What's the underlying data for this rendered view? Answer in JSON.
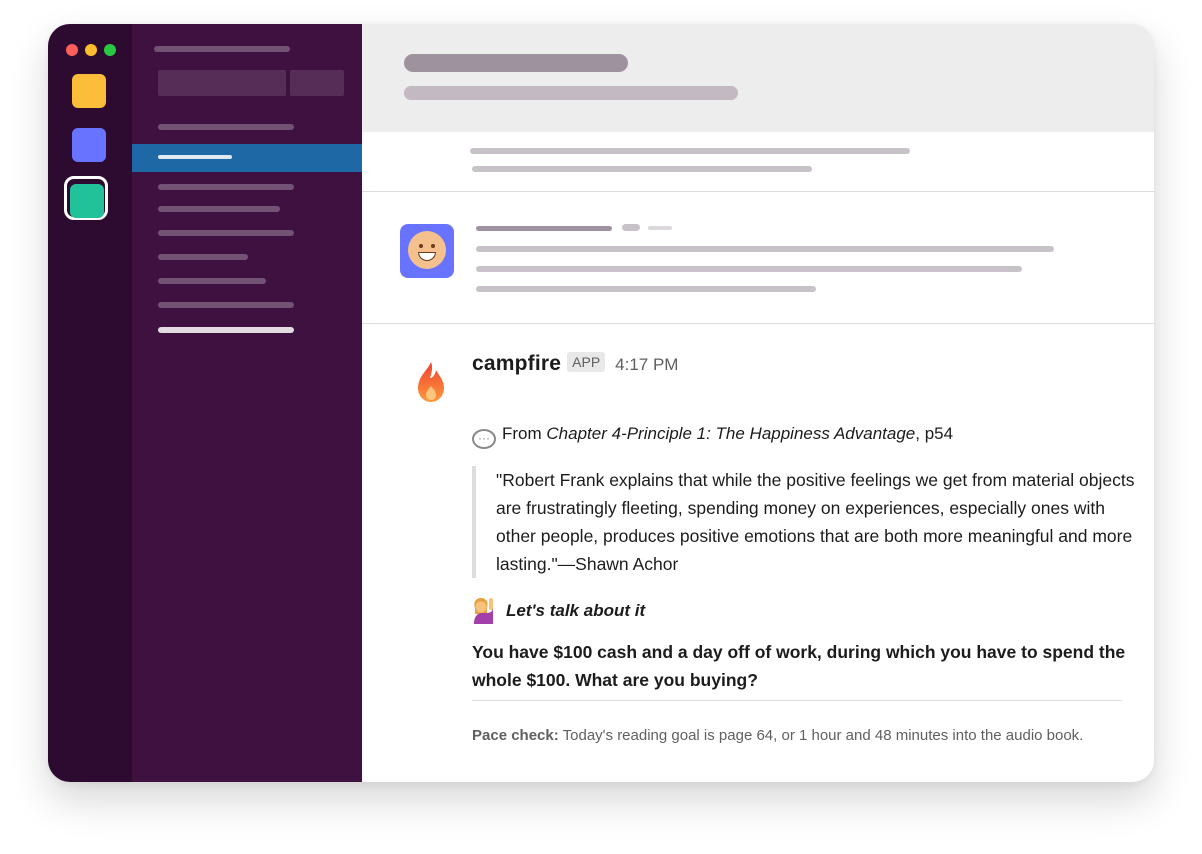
{
  "colors": {
    "rail": "#2d0a2f",
    "sidebar": "#3e1140",
    "active": "#1e68a6",
    "workspace_yellow": "#fcbe3a",
    "workspace_blue": "#6874ff",
    "workspace_green": "#21c19a",
    "traffic_red": "#fe5f58",
    "traffic_yellow": "#febc2e",
    "traffic_green": "#28c840"
  },
  "message": {
    "sender": "campfire",
    "badge": "APP",
    "time": "4:17 PM",
    "source_prefix": "From ",
    "source_title": "Chapter 4-Principle 1: The Happiness Advantage",
    "source_suffix": ", p54",
    "quote": "\"Robert Frank explains that while the positive feelings we get from material objects are frustratingly fleeting, spending money on experiences, especially ones with other people, produces positive emotions that are both more meaningful and more lasting.\"—Shawn Achor",
    "talk_label": "Let's talk about it",
    "question": "You have $100 cash and a day off of work, during which you have to spend the whole $100. What are you buying?",
    "pace_label": "Pace check:",
    "pace_text": " Today's reading goal is page 64, or 1 hour and 48 minutes into the audio book."
  },
  "icons": {
    "sender_avatar": "flame-icon",
    "source_icon": "speech-bubble-icon",
    "talk_icon": "person-raising-hand-icon",
    "placeholder_avatar": "smiling-face-icon"
  }
}
